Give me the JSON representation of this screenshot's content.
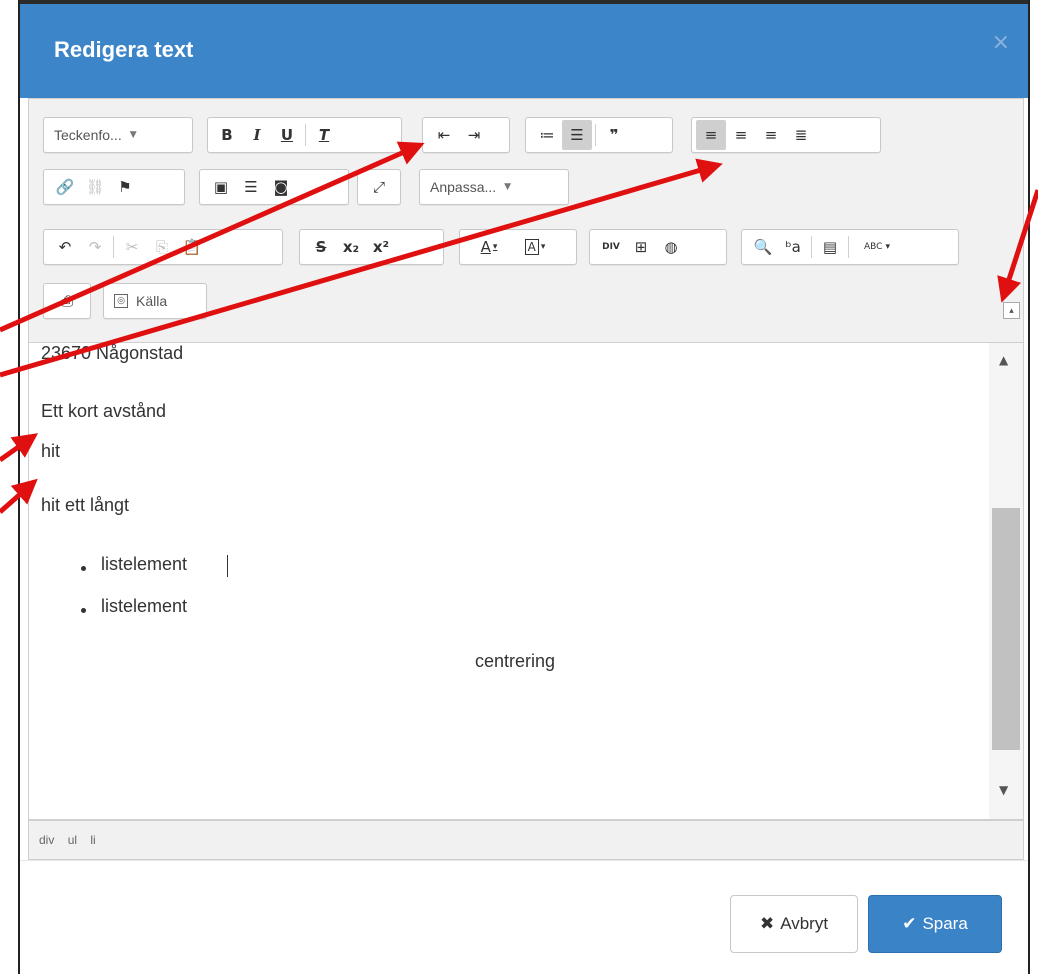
{
  "dialog": {
    "title": "Redigera text",
    "close_glyph": "×"
  },
  "toolbar": {
    "row1": {
      "format_combo": "Teckenfo...",
      "bold": "B",
      "italic": "I",
      "underline": "U",
      "clear_format": "T",
      "outdent": "⇤",
      "indent": "⇥",
      "numbered_list": "≔",
      "bulleted_list": "☰",
      "blockquote": "❞",
      "align_left": "≡",
      "align_center": "≡",
      "align_right": "≡",
      "align_justify": "≣"
    },
    "row2": {
      "link": "🔗",
      "unlink": "⛓",
      "anchor": "⚑",
      "image": "▣",
      "hr": "☰",
      "flash": "◙",
      "maximize": "⤢",
      "styles_combo": "Anpassa..."
    },
    "row3": {
      "undo": "↶",
      "redo": "↷",
      "cut": "✂",
      "copy": "⎘",
      "paste": "📋",
      "strike": "S",
      "subscript": "x₂",
      "superscript": "x²",
      "text_color": "A",
      "bg_color": "A",
      "div": "DIV",
      "table": "⊞",
      "special": "◍",
      "find": "🔍",
      "replace": "ᵇa",
      "page_break": "▤",
      "spellcheck": "ABC"
    },
    "row4": {
      "preview": "⎙",
      "source_label": "Källa"
    }
  },
  "content": {
    "line1": "23670 Någonstad",
    "line2": "Ett kort avstånd",
    "line3": "hit",
    "line4": "hit ett långt",
    "list_items": [
      "listelement",
      "listelement"
    ],
    "centered": "centrering"
  },
  "statusbar": {
    "path": [
      "div",
      "ul",
      "li"
    ]
  },
  "buttons": {
    "cancel": "Avbryt",
    "save": "Spara"
  },
  "colors": {
    "header": "#3d85c9",
    "save_button": "#3a83c7",
    "arrow": "#e01010"
  }
}
